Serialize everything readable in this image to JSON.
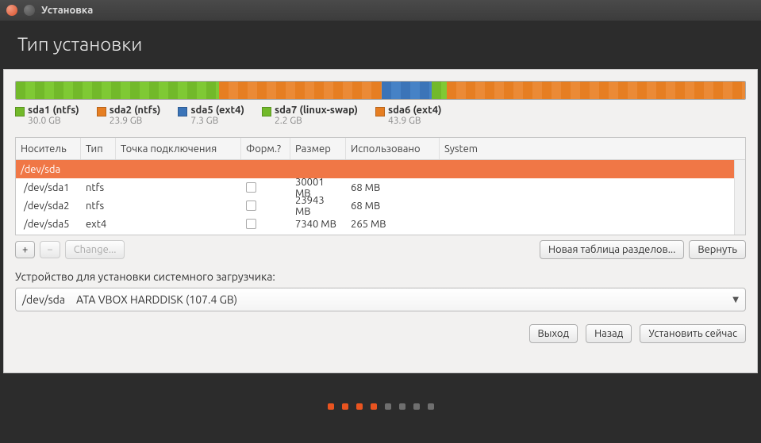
{
  "window": {
    "title": "Установка"
  },
  "header": {
    "title": "Тип установки"
  },
  "bar": {
    "segments": [
      {
        "color": "green",
        "pct": 27.9
      },
      {
        "color": "orange",
        "pct": 22.3
      },
      {
        "color": "blue",
        "pct": 6.8
      },
      {
        "color": "green",
        "pct": 2.1
      },
      {
        "color": "orange",
        "pct": 40.9
      }
    ]
  },
  "legend": [
    {
      "color": "#72b92a",
      "label": "sda1 (ntfs)",
      "size": "30.0 GB"
    },
    {
      "color": "#e67e22",
      "label": "sda2 (ntfs)",
      "size": "23.9 GB"
    },
    {
      "color": "#3b74b8",
      "label": "sda5 (ext4)",
      "size": "7.3 GB"
    },
    {
      "color": "#72b92a",
      "label": "sda7 (linux-swap)",
      "size": "2.2 GB"
    },
    {
      "color": "#e67e22",
      "label": "sda6 (ext4)",
      "size": "43.9 GB"
    }
  ],
  "table": {
    "headers": {
      "c1": "Носитель",
      "c2": "Тип",
      "c3": "Точка подключения",
      "c4": "Форм.?",
      "c5": "Размер",
      "c6": "Использовано",
      "c7": "System"
    },
    "rows": [
      {
        "device": "/dev/sda",
        "selected": true
      },
      {
        "device": "/dev/sda1",
        "type": "ntfs",
        "format": false,
        "size": "30001 MB",
        "used": "68 MB"
      },
      {
        "device": "/dev/sda2",
        "type": "ntfs",
        "format": false,
        "size": "23943 MB",
        "used": "68 MB"
      },
      {
        "device": "/dev/sda5",
        "type": "ext4",
        "format": false,
        "size": "7340 MB",
        "used": "265 MB"
      }
    ]
  },
  "toolbar": {
    "plus": "+",
    "minus": "−",
    "change": "Change...",
    "newtable": "Новая таблица разделов...",
    "revert": "Вернуть"
  },
  "bootloader": {
    "label": "Устройство для установки системного загрузчика:",
    "device": "/dev/sda",
    "desc": "ATA VBOX HARDDISK (107.4 GB)"
  },
  "footer": {
    "quit": "Выход",
    "back": "Назад",
    "install": "Установить сейчас"
  },
  "dots": {
    "total": 8,
    "active": [
      0,
      1,
      2,
      3
    ]
  }
}
